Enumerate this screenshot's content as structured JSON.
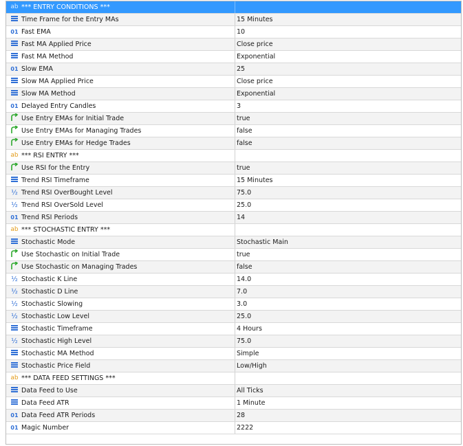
{
  "parameters": [
    {
      "icon": "text-icon",
      "name": "*** ENTRY CONDITIONS ***",
      "value": "",
      "selected": true
    },
    {
      "icon": "list-icon",
      "name": "Time Frame for the Entry MAs",
      "value": "15 Minutes"
    },
    {
      "icon": "integer-icon",
      "name": "Fast EMA",
      "value": "10"
    },
    {
      "icon": "list-icon",
      "name": "Fast MA Applied Price",
      "value": "Close price"
    },
    {
      "icon": "list-icon",
      "name": "Fast MA Method",
      "value": "Exponential"
    },
    {
      "icon": "integer-icon",
      "name": "Slow EMA",
      "value": "25"
    },
    {
      "icon": "list-icon",
      "name": "Slow MA Applied Price",
      "value": "Close price"
    },
    {
      "icon": "list-icon",
      "name": "Slow MA Method",
      "value": "Exponential"
    },
    {
      "icon": "integer-icon",
      "name": "Delayed Entry Candles",
      "value": "3"
    },
    {
      "icon": "boolean-icon",
      "name": "Use Entry EMAs for Initial Trade",
      "value": "true"
    },
    {
      "icon": "boolean-icon",
      "name": "Use Entry EMAs for Managing Trades",
      "value": "false"
    },
    {
      "icon": "boolean-icon",
      "name": "Use Entry EMAs for Hedge Trades",
      "value": "false"
    },
    {
      "icon": "text-icon",
      "name": "*** RSI ENTRY ***",
      "value": ""
    },
    {
      "icon": "boolean-icon",
      "name": "Use RSI for the Entry",
      "value": "true"
    },
    {
      "icon": "list-icon",
      "name": "Trend RSI Timeframe",
      "value": "15 Minutes"
    },
    {
      "icon": "double-icon",
      "name": "Trend RSI OverBought Level",
      "value": "75.0"
    },
    {
      "icon": "double-icon",
      "name": "Trend RSI OverSold Level",
      "value": "25.0"
    },
    {
      "icon": "integer-icon",
      "name": "Trend RSI Periods",
      "value": "14"
    },
    {
      "icon": "text-icon",
      "name": "*** STOCHASTIC ENTRY ***",
      "value": ""
    },
    {
      "icon": "list-icon",
      "name": "Stochastic Mode",
      "value": "Stochastic Main"
    },
    {
      "icon": "boolean-icon",
      "name": "Use Stochastic on Initial Trade",
      "value": "true"
    },
    {
      "icon": "boolean-icon",
      "name": "Use Stochastic on Managing Trades",
      "value": "false"
    },
    {
      "icon": "double-icon",
      "name": "Stochastic K Line",
      "value": "14.0"
    },
    {
      "icon": "double-icon",
      "name": "Stochastic D Line",
      "value": "7.0"
    },
    {
      "icon": "double-icon",
      "name": "Stochastic Slowing",
      "value": "3.0"
    },
    {
      "icon": "double-icon",
      "name": "Stochastic Low Level",
      "value": "25.0"
    },
    {
      "icon": "list-icon",
      "name": "Stochastic Timeframe",
      "value": "4 Hours"
    },
    {
      "icon": "double-icon",
      "name": "Stochastic High Level",
      "value": "75.0"
    },
    {
      "icon": "list-icon",
      "name": "Stochastic MA Method",
      "value": "Simple"
    },
    {
      "icon": "list-icon",
      "name": "Stochastic Price Field",
      "value": "Low/High"
    },
    {
      "icon": "text-icon",
      "name": "*** DATA FEED SETTINGS ***",
      "value": ""
    },
    {
      "icon": "list-icon",
      "name": "Data Feed to Use",
      "value": "All Ticks"
    },
    {
      "icon": "list-icon",
      "name": "Data Feed ATR",
      "value": "1 Minute"
    },
    {
      "icon": "integer-icon",
      "name": "Data Feed ATR Periods",
      "value": "28"
    },
    {
      "icon": "integer-icon",
      "name": "Magic Number",
      "value": "2222"
    }
  ],
  "icon_glyphs": {
    "text-icon": "ab",
    "integer-icon": "01",
    "double-icon": "½"
  },
  "colors": {
    "selected_row": "#3399ff",
    "alt_row": "#f3f3f3",
    "list_icon": "#2f6fd6",
    "boolean_icon": "#2da82d",
    "text_icon": "#e39b18"
  }
}
